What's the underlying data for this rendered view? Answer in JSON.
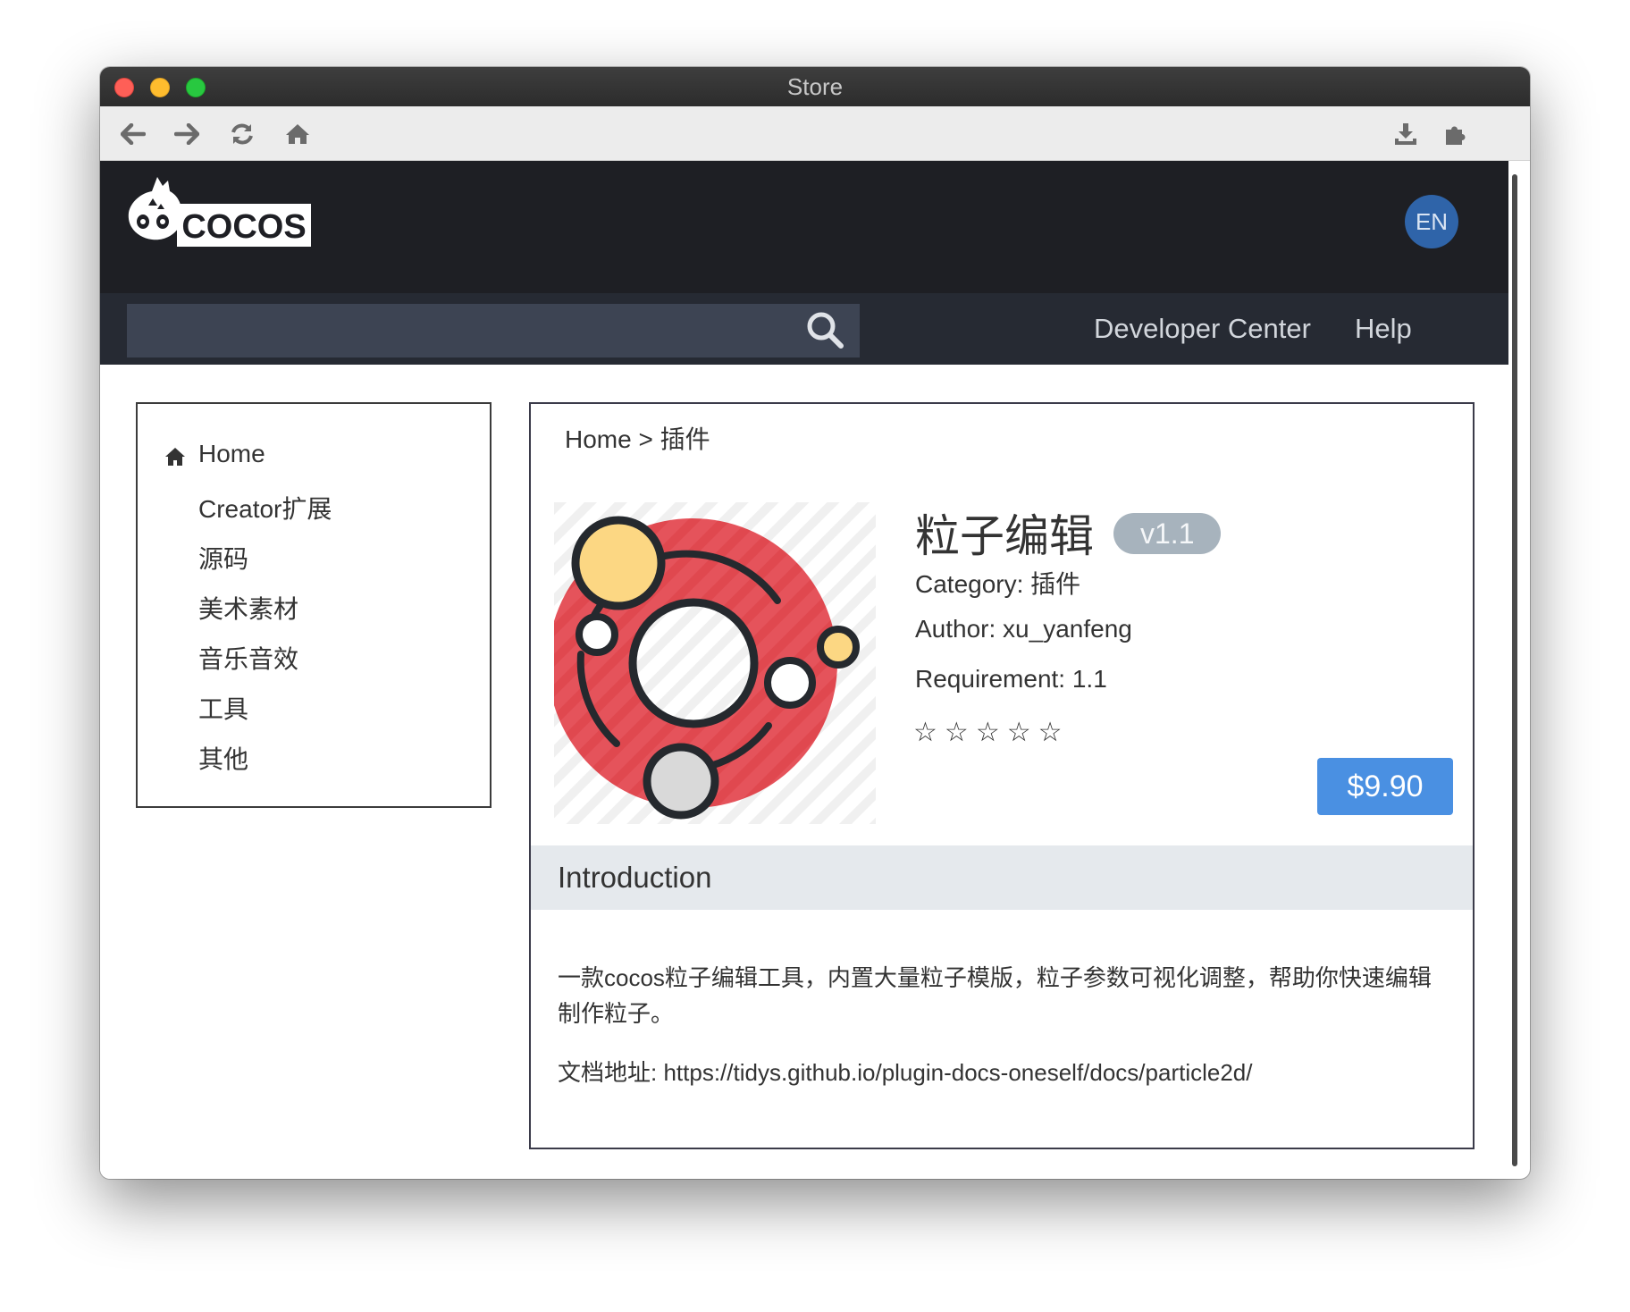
{
  "window": {
    "title": "Store"
  },
  "toolbar": {
    "icons": [
      "back-icon",
      "forward-icon",
      "reload-icon",
      "home-icon",
      "download-icon",
      "extension-icon"
    ]
  },
  "header": {
    "logo_text": "COCOS",
    "lang_button": "EN"
  },
  "nav": {
    "search_placeholder": "",
    "links": [
      "Developer Center",
      "Help"
    ]
  },
  "sidebar": {
    "items": [
      "Home",
      "Creator扩展",
      "源码",
      "美术素材",
      "音乐音效",
      "工具",
      "其他"
    ]
  },
  "breadcrumb": {
    "home": "Home",
    "separator": ">",
    "current": "插件"
  },
  "product": {
    "title": "粒子编辑",
    "version": "v1.1",
    "category": "Category: 插件",
    "author": "Author: xu_yanfeng",
    "requirement": "Requirement: 1.1",
    "rating_stars": 5,
    "rating_filled": 0,
    "price": "$9.90"
  },
  "introduction": {
    "heading": "Introduction",
    "description": "一款cocos粒子编辑工具，内置大量粒子模版，粒子参数可视化调整，帮助你快速编辑制作粒子。",
    "docs": "文档地址: https://tidys.github.io/plugin-docs-oneself/docs/particle2d/"
  },
  "colors": {
    "header_bg": "#1e1f24",
    "nav_bg": "#262a33",
    "search_bg": "#3d4453",
    "lang_badge": "#2f64a9",
    "price_button": "#4a90e2",
    "version_badge": "#a7b3bd",
    "intro_bar": "#e5e9ed",
    "icon_red": "#e5535b",
    "icon_yellow": "#fcd783"
  }
}
